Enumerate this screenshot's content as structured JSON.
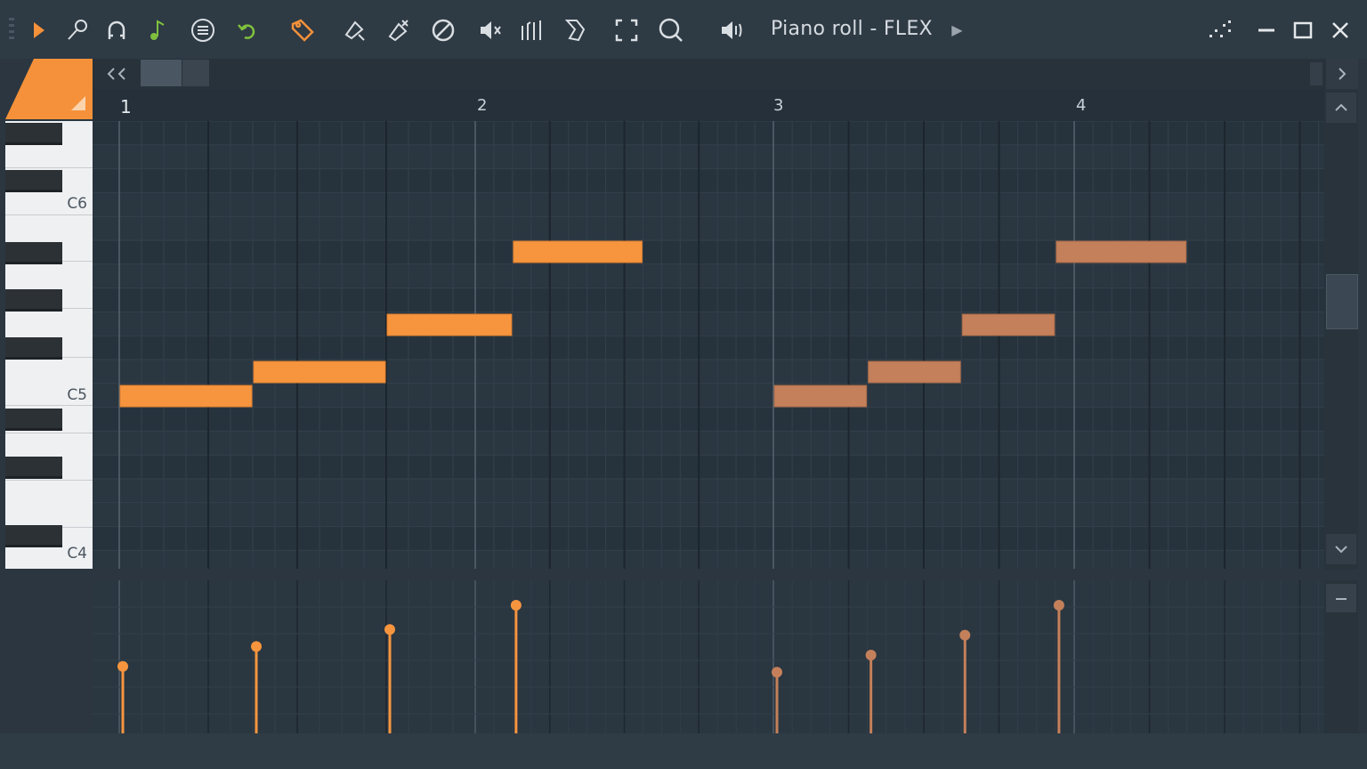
{
  "window": {
    "title": "Piano roll - FLEX",
    "controls": [
      "minimize",
      "maximize",
      "close"
    ]
  },
  "toolbar": {
    "icons": [
      "play-icon",
      "wrench-icon",
      "magnet-icon",
      "note-icon",
      "menu-icon",
      "undo-icon",
      "pencil-icon",
      "paint-icon",
      "delete-icon",
      "mute-icon",
      "slice-icon",
      "slip-icon",
      "select-icon",
      "zoom-icon",
      "speaker-icon"
    ],
    "accent": "#f4913a",
    "undo_color": "#7fc03e"
  },
  "ruler": {
    "bars": [
      "1",
      "2",
      "3",
      "4"
    ]
  },
  "piano": {
    "labels": [
      "C6",
      "C5",
      "C4"
    ]
  },
  "colors": {
    "note_active": "#f7953f",
    "note_ghost": "#c4805a",
    "grid_bg": "#2a3640",
    "grid_alt": "#2d3a45"
  },
  "notes": [
    {
      "pitch": "G#4",
      "start_beat": 0.0,
      "length_beats": 1.5,
      "velocity": 0.47,
      "ghost": false
    },
    {
      "pitch": "A#4",
      "start_beat": 1.5,
      "length_beats": 1.5,
      "velocity": 0.61,
      "ghost": false
    },
    {
      "pitch": "C#5",
      "start_beat": 3.0,
      "length_beats": 1.5,
      "velocity": 0.73,
      "ghost": false
    },
    {
      "pitch": "G5",
      "start_beat": 4.5,
      "length_beats": 1.75,
      "velocity": 0.9,
      "ghost": false
    },
    {
      "pitch": "G#4",
      "start_beat": 8.0,
      "length_beats": 1.25,
      "velocity": 0.43,
      "ghost": true
    },
    {
      "pitch": "A#4",
      "start_beat": 9.25,
      "length_beats": 1.25,
      "velocity": 0.55,
      "ghost": true
    },
    {
      "pitch": "C#5",
      "start_beat": 10.5,
      "length_beats": 1.25,
      "velocity": 0.69,
      "ghost": true
    },
    {
      "pitch": "G5",
      "start_beat": 11.75,
      "length_beats": 1.75,
      "velocity": 0.9,
      "ghost": true
    }
  ]
}
